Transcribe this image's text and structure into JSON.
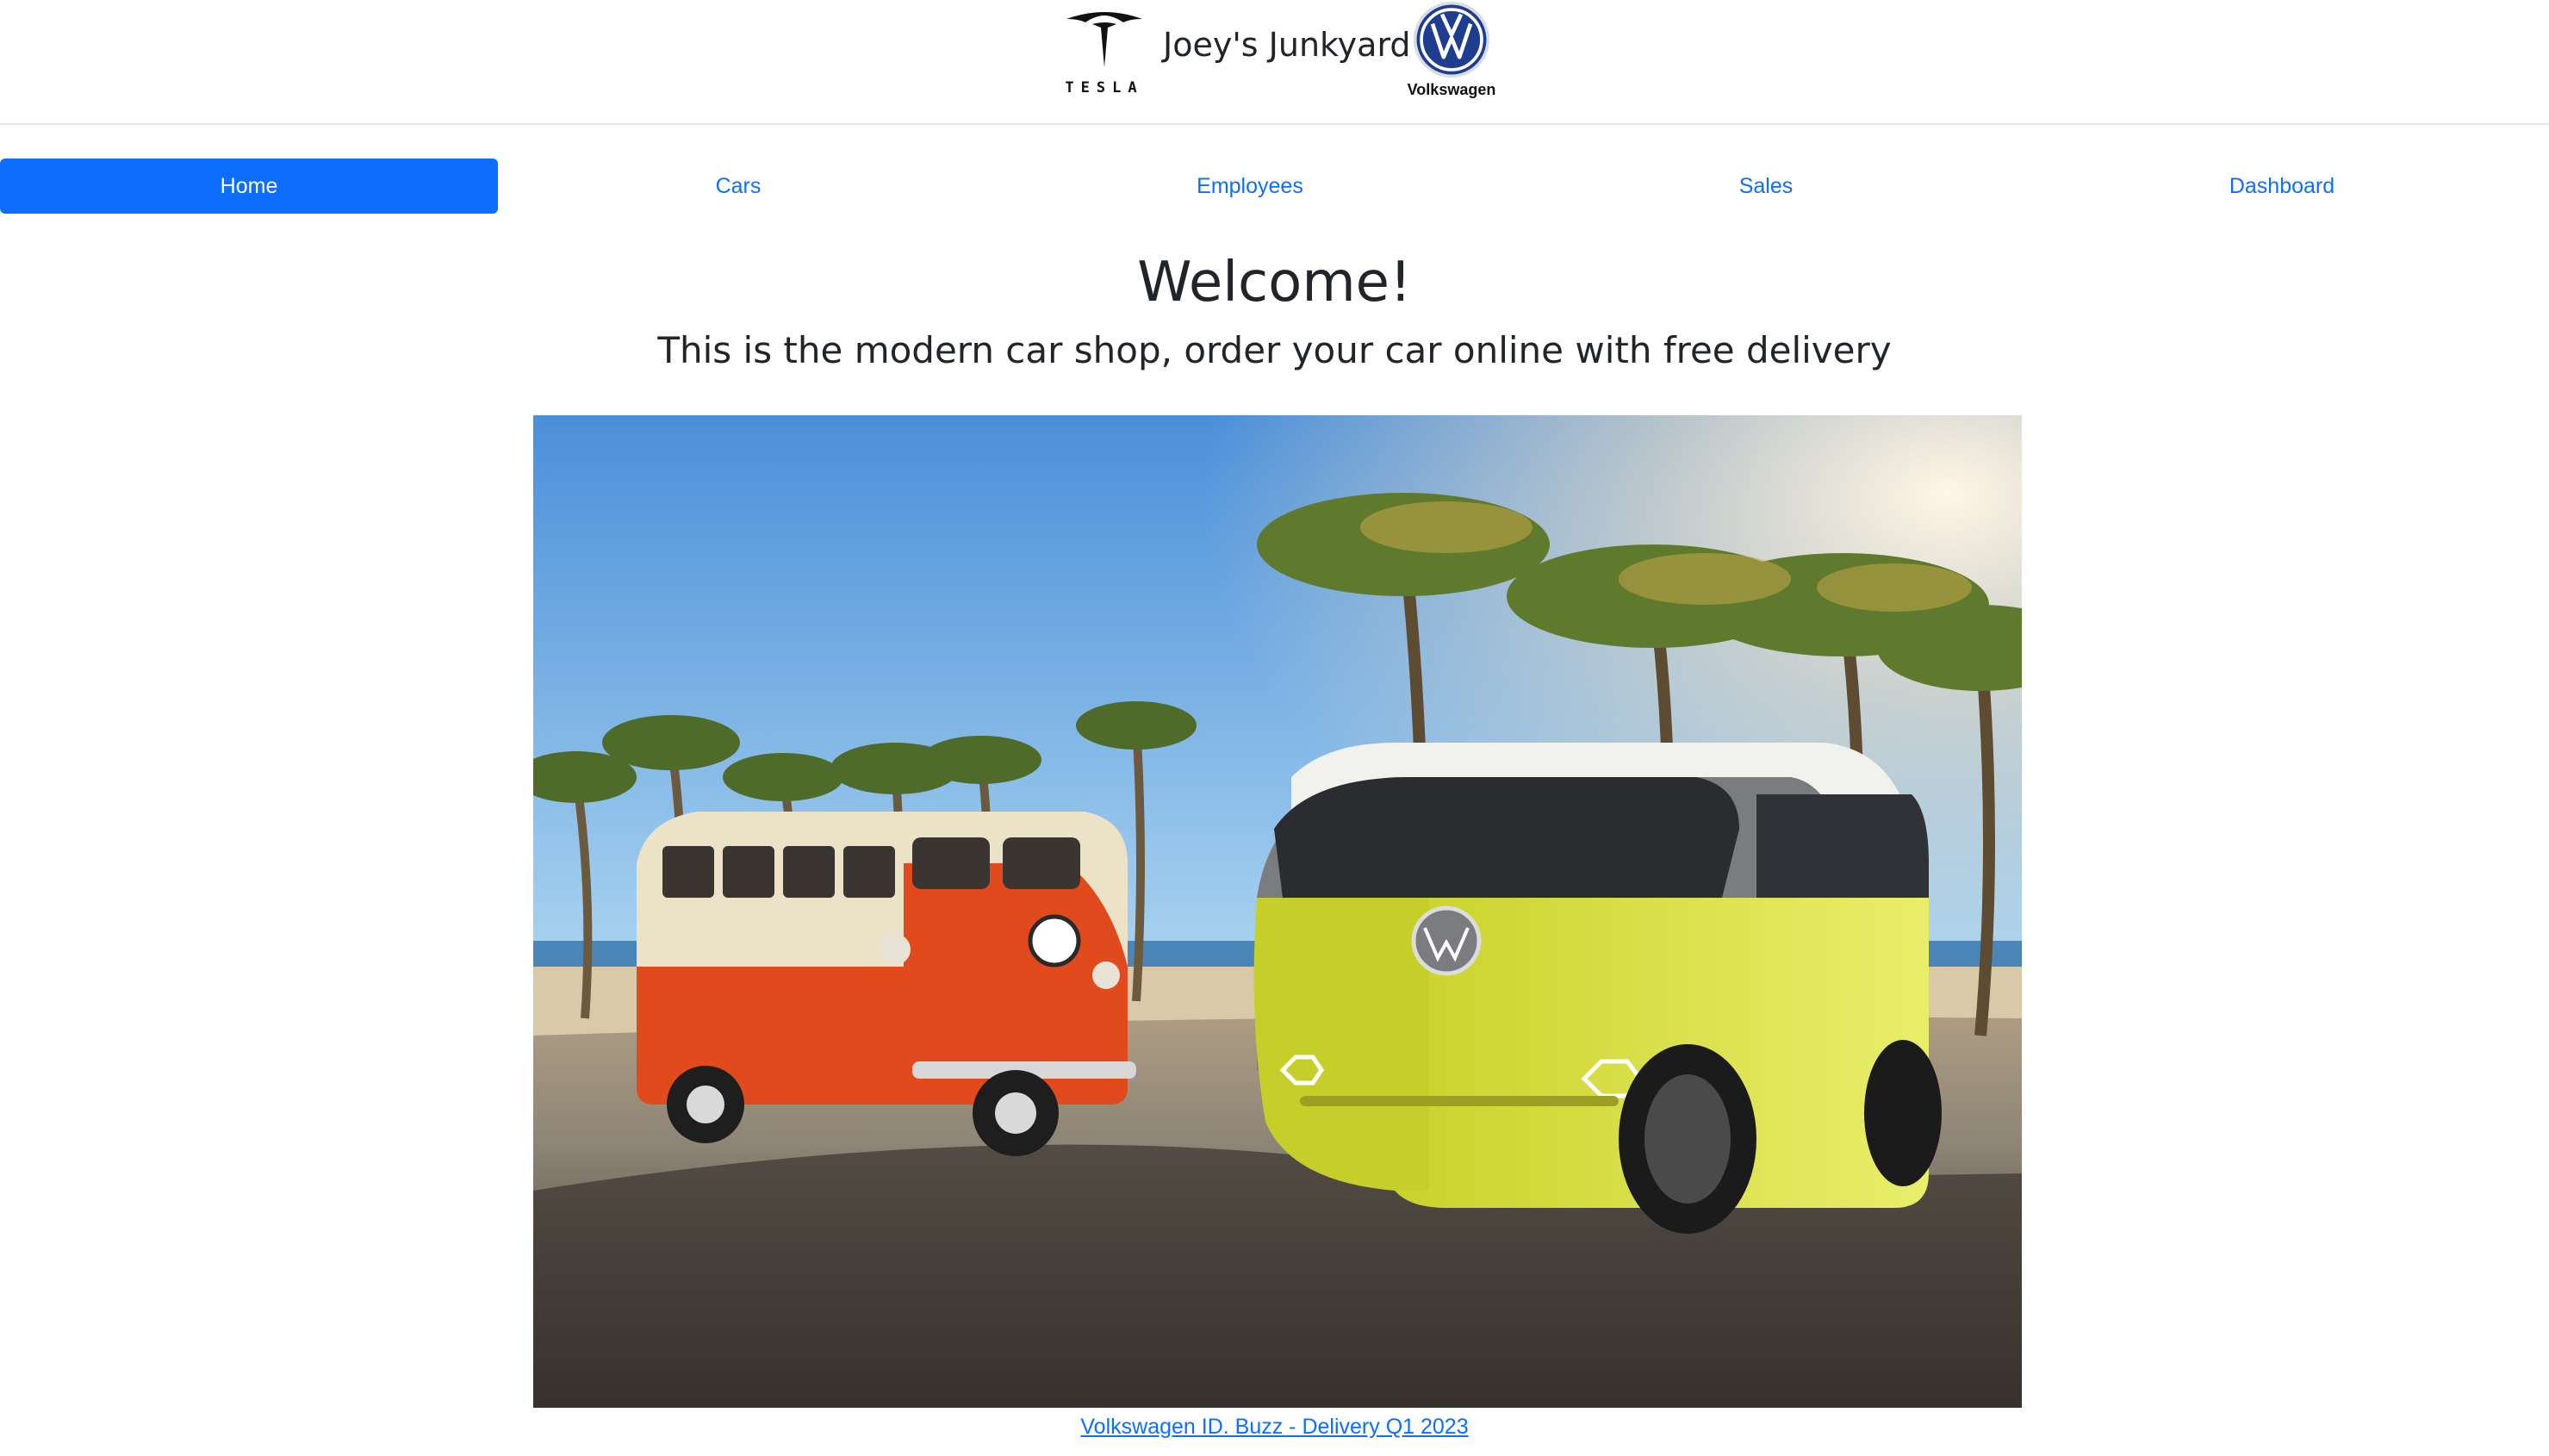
{
  "header": {
    "logo_left_icon": "tesla-logo",
    "logo_left_wordmark": "TESLA",
    "title": "Joey's Junkyard",
    "logo_right_icon": "volkswagen-logo",
    "logo_right_wordmark": "Volkswagen"
  },
  "nav": {
    "items": [
      {
        "label": "Home",
        "active": true
      },
      {
        "label": "Cars",
        "active": false
      },
      {
        "label": "Employees",
        "active": false
      },
      {
        "label": "Sales",
        "active": false
      },
      {
        "label": "Dashboard",
        "active": false
      }
    ]
  },
  "main": {
    "heading": "Welcome!",
    "subheading": "This is the modern car shop, order your car online with free delivery",
    "hero_image_subject": "vintage-vw-bus-and-id-buzz",
    "caption_link": "Volkswagen ID. Buzz - Delivery Q1 2023"
  },
  "colors": {
    "primary": "#0d6efd",
    "text": "#212529",
    "vw_blue": "#1e3d8f"
  }
}
